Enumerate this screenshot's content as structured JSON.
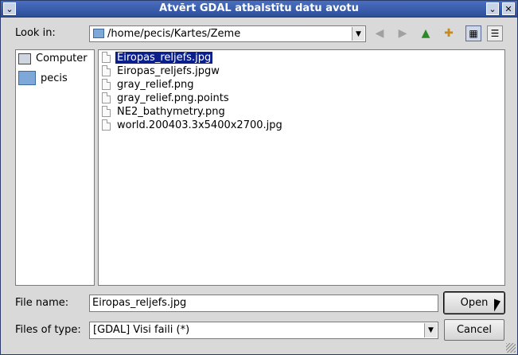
{
  "window": {
    "title": "Atvērt GDAL atbalstītu datu avotu"
  },
  "look_in": {
    "label": "Look in:",
    "path": "/home/pecis/Kartes/Zeme"
  },
  "toolbar": {
    "icons": [
      "back-arrow-icon",
      "forward-arrow-icon",
      "up-folder-icon",
      "new-folder-icon",
      "list-view-icon",
      "detail-view-icon"
    ]
  },
  "sidebar": {
    "items": [
      {
        "label": "Computer",
        "icon": "computer-icon"
      },
      {
        "label": "pecis",
        "icon": "folder-icon"
      }
    ]
  },
  "files": [
    {
      "name": "Eiropas_reljefs.jpg",
      "selected": true
    },
    {
      "name": "Eiropas_reljefs.jpgw",
      "selected": false
    },
    {
      "name": "gray_relief.png",
      "selected": false
    },
    {
      "name": "gray_relief.png.points",
      "selected": false
    },
    {
      "name": "NE2_bathymetry.png",
      "selected": false
    },
    {
      "name": "world.200403.3x5400x2700.jpg",
      "selected": false
    }
  ],
  "filename": {
    "label": "File name:",
    "value": "Eiropas_reljefs.jpg"
  },
  "filetype": {
    "label": "Files of type:",
    "value": "[GDAL] Visi faili (*)"
  },
  "buttons": {
    "open": "Open",
    "cancel": "Cancel"
  }
}
